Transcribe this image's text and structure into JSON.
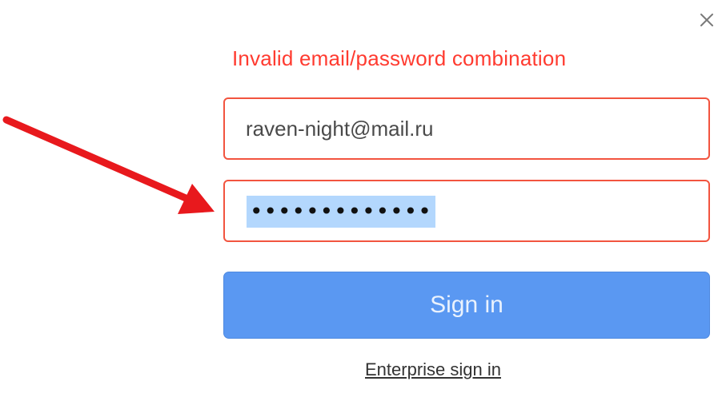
{
  "dialog": {
    "error_message": "Invalid email/password combination",
    "email_value": "raven-night@mail.ru",
    "password_masked": "•••••••••••••",
    "signin_label": "Sign in",
    "enterprise_label": "Enterprise sign in"
  },
  "icons": {
    "close": "close-icon",
    "annotation": "arrow-annotation"
  },
  "colors": {
    "error": "#ff3b30",
    "field_border_error": "#f2543f",
    "button_primary": "#5a98f2",
    "selection": "#b3d7fd",
    "annotation_arrow": "#e8191d"
  }
}
